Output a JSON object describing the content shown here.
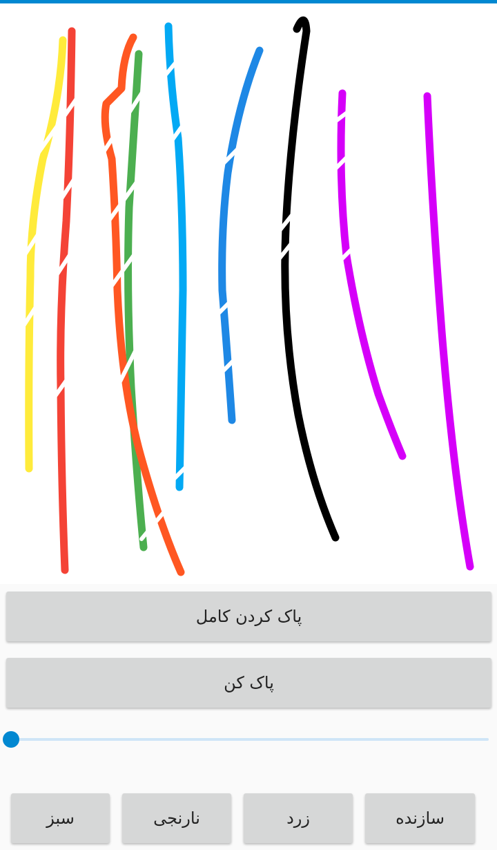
{
  "drawing": {
    "stroke_colors": {
      "yellow": "#ffeb3b",
      "red": "#f44336",
      "orange": "#ff5722",
      "green": "#4caf50",
      "light_blue": "#03a9f4",
      "blue": "#1e88e5",
      "black": "#000000",
      "purple": "#d500f9"
    }
  },
  "buttons": {
    "clear_all": "پاک کردن کامل",
    "eraser": "پاک کن"
  },
  "brush_size_slider": {
    "value": 0
  },
  "color_buttons": {
    "green": "سبز",
    "orange": "نارنجی",
    "yellow": "زرد",
    "maker": "سازنده"
  },
  "accent_color": "#0288d1"
}
